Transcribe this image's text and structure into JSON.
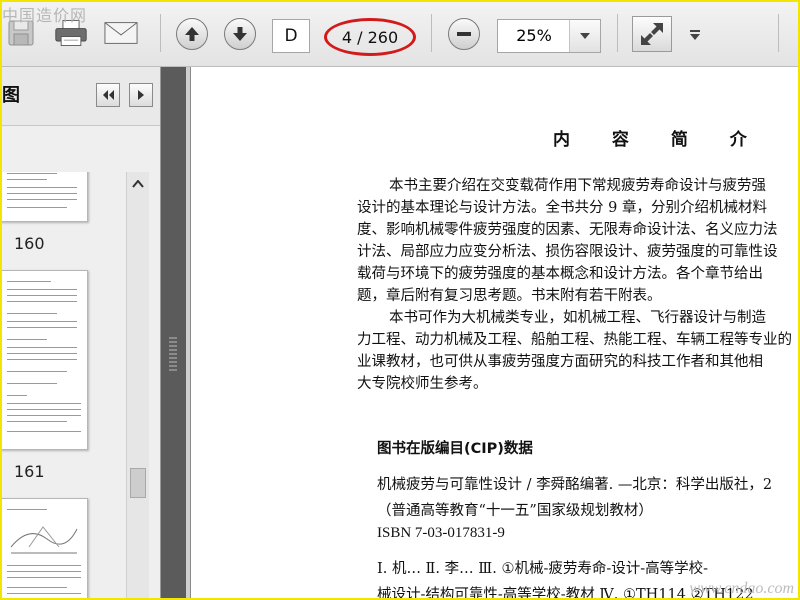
{
  "watermarks": {
    "top_left": "中国造价网",
    "bottom_right": "www.cndao.com"
  },
  "toolbar": {
    "page_input": "D",
    "page_count": "4 / 260",
    "zoom_value": "25%"
  },
  "thumbnails_panel": {
    "title": "图",
    "thumbs": [
      {
        "label": "160"
      },
      {
        "label": "161"
      }
    ]
  },
  "document": {
    "title": "内 容 简 介",
    "para1": [
      "本书主要介绍在交变载荷作用下常规疲劳寿命设计与疲劳强",
      "设计的基本理论与设计方法。全书共分 9 章，分别介绍机械材料",
      "度、影响机械零件疲劳强度的因素、无限寿命设计法、名义应力法",
      "计法、局部应力应变分析法、损伤容限设计、疲劳强度的可靠性设",
      "载荷与环境下的疲劳强度的基本概念和设计方法。各个章节给出",
      "题，章后附有复习思考题。书末附有若干附表。"
    ],
    "para2": [
      "本书可作为大机械类专业，如机械工程、飞行器设计与制造",
      "力工程、动力机械及工程、船舶工程、热能工程、车辆工程等专业的",
      "业课教材，也可供从事疲劳强度方面研究的科技工作者和其他相",
      "大专院校师生参考。"
    ],
    "cip_heading": "图书在版编目(CIP)数据",
    "cip_lines": [
      "机械疲劳与可靠性设计 / 李舜酩编著. —北京：科学出版社，2",
      "（普通高等教育“十一五”国家级规划教材）",
      "ISBN 7-03-017831-9",
      "Ⅰ. 机… Ⅱ. 李… Ⅲ. ①机械-疲劳寿命-设计-高等学校-",
      "械设计-结构可靠性-高等学校-教材 Ⅳ. ①TH114 ②TH122"
    ]
  }
}
